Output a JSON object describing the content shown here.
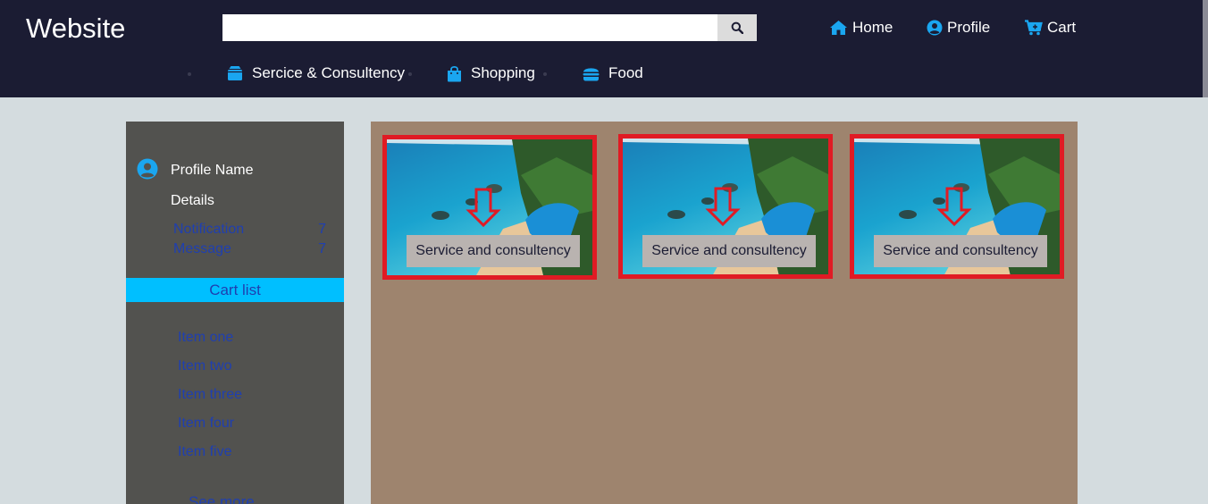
{
  "header": {
    "logo": "Website",
    "search": {
      "value": "",
      "placeholder": "",
      "button_icon": "search-icon"
    },
    "top_nav": [
      {
        "label": "Home",
        "icon": "home-icon"
      },
      {
        "label": "Profile",
        "icon": "user-circle-icon"
      },
      {
        "label": "Cart",
        "icon": "cart-plus-icon"
      }
    ],
    "categories": [
      {
        "label": "Sercice & Consultency",
        "icon": "box-icon"
      },
      {
        "label": "Shopping",
        "icon": "shopping-bag-icon"
      },
      {
        "label": "Food",
        "icon": "hamburger-icon"
      }
    ]
  },
  "sidebar": {
    "profile_name": "Profile Name",
    "details": "Details",
    "stats": [
      {
        "label": "Notification",
        "count": "7"
      },
      {
        "label": "Message",
        "count": "7"
      }
    ],
    "cart_list_title": "Cart list",
    "cart_items": [
      "Item one",
      "Item two",
      "Item three",
      "Item four",
      "Item five"
    ],
    "see_more": "See more"
  },
  "cards": [
    {
      "label": "Service and consultency",
      "image": "beach-resort-photo",
      "overlay": "down-arrow-icon"
    },
    {
      "label": "Service and consultency",
      "image": "beach-resort-photo",
      "overlay": "down-arrow-icon"
    },
    {
      "label": "Service and consultency",
      "image": "beach-resort-photo",
      "overlay": "down-arrow-icon"
    }
  ],
  "colors": {
    "header_bg": "#1b1c33",
    "page_bg": "#d4dcdf",
    "sidebar_bg": "#52524f",
    "main_bg": "#9e846e",
    "accent": "#00bfff",
    "link": "#1f3fb0",
    "card_border": "#e01b24"
  }
}
